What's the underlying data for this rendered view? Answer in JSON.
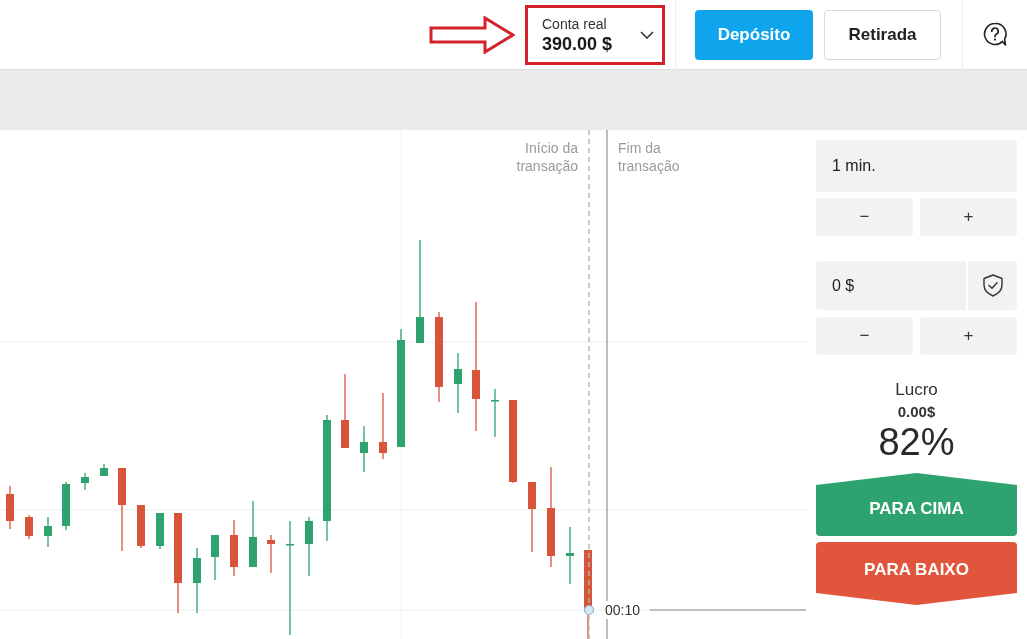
{
  "header": {
    "account": {
      "label": "Conta real",
      "balance": "390.00 $",
      "highlighted": true
    },
    "buttons": [
      {
        "label": "Depósito",
        "kind": "primary"
      },
      {
        "label": "Retirada",
        "kind": "secondary"
      }
    ]
  },
  "chart": {
    "start_label": "Início da transação",
    "end_label": "Fim da transação",
    "timer": "00:10"
  },
  "trade_panel": {
    "duration": {
      "value": "1 min.",
      "minus": "−",
      "plus": "+"
    },
    "amount": {
      "value": "0 $",
      "minus": "−",
      "plus": "+"
    },
    "profit": {
      "label": "Lucro",
      "amount": "0.00$",
      "percent": "82%"
    },
    "actions": [
      {
        "label": "PARA CIMA",
        "kind": "up"
      },
      {
        "label": "PARA BAIXO",
        "kind": "down"
      }
    ]
  }
}
